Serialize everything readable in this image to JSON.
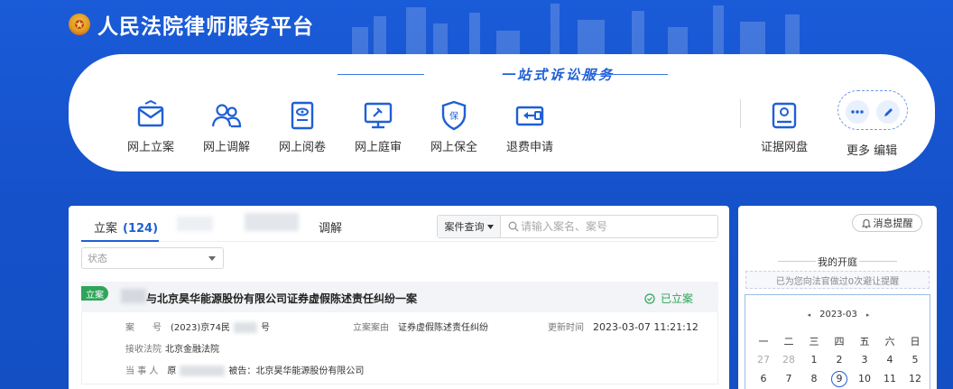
{
  "header": {
    "title": "人民法院律师服务平台"
  },
  "services": {
    "slogan": "一站式诉讼服务",
    "items": [
      {
        "label": "网上立案",
        "icon": "envelope-icon"
      },
      {
        "label": "网上调解",
        "icon": "users-icon"
      },
      {
        "label": "网上阅卷",
        "icon": "file-view-icon"
      },
      {
        "label": "网上庭审",
        "icon": "court-monitor-icon"
      },
      {
        "label": "网上保全",
        "icon": "shield-icon"
      },
      {
        "label": "退费申请",
        "icon": "refund-icon"
      }
    ],
    "evidence_label": "证据网盘",
    "more_edit_label": "更多 编辑"
  },
  "cases": {
    "tab_filing_label": "立案",
    "tab_filing_count": "(124)",
    "tab_mediation_label": "调解",
    "search_type": "案件查询",
    "search_placeholder": "请输入案名、案号",
    "status_placeholder": "状态",
    "case": {
      "tag": "立案",
      "title": "与北京昊华能源股份有限公司证券虚假陈述责任纠纷一案",
      "status": "已立案",
      "case_no_label": "案　　号",
      "case_no_prefix": "(2023)京74民",
      "case_no_suffix": "号",
      "cause_label": "立案案由",
      "cause": "证券虚假陈述责任纠纷",
      "updated_label": "更新时间",
      "updated": "2023-03-07 11:21:12",
      "court_label": "接收法院",
      "court": "北京金融法院",
      "party_label": "当 事 人",
      "party_prefix": "原",
      "defendant": "被告：北京昊华能源股份有限公司"
    }
  },
  "side": {
    "notify_label": "消息提醒",
    "court_title": "我的开庭",
    "reminder": "已为您向法官做过0次避让提醒",
    "calendar": {
      "month": "2023-03",
      "prev": "◂",
      "next": "▸",
      "weekdays": [
        "一",
        "二",
        "三",
        "四",
        "五",
        "六",
        "日"
      ],
      "rows": [
        [
          "27",
          "28",
          "1",
          "2",
          "3",
          "4",
          "5"
        ],
        [
          "6",
          "7",
          "8",
          "9",
          "10",
          "11",
          "12"
        ]
      ],
      "today": "9"
    }
  },
  "colors": {
    "brand_blue": "#1a5bd8",
    "accent": "#1f5fd6",
    "success": "#2fa55a"
  }
}
